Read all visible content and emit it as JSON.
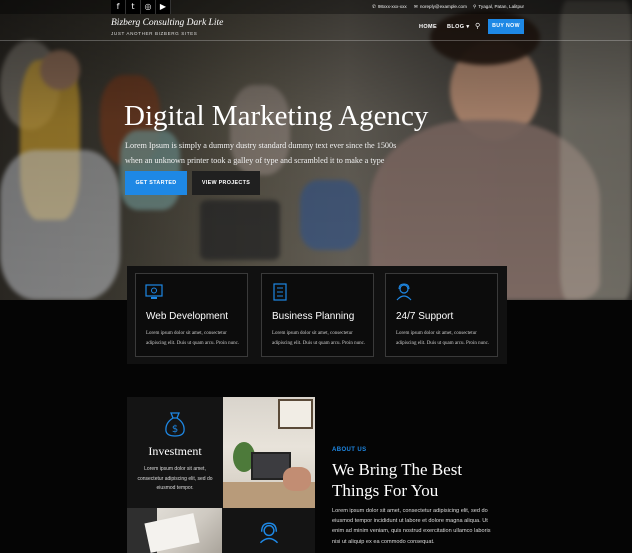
{
  "topbar": {
    "social": [
      {
        "name": "facebook-icon",
        "glyph": "f"
      },
      {
        "name": "twitter-icon",
        "glyph": "t"
      },
      {
        "name": "instagram-icon",
        "glyph": "◎"
      },
      {
        "name": "youtube-icon",
        "glyph": "▶"
      }
    ],
    "phone": "98xxx-xxx-xxx",
    "email": "noreply@example.com",
    "location": "Tyagal, Patan, Lalitpur"
  },
  "header": {
    "site_title": "Bizberg Consulting Dark Lite",
    "tagline": "JUST ANOTHER BIZBERG SITES",
    "nav": {
      "home": "HOME",
      "blog": "BLOG ▾"
    },
    "buy_now": "BUY NOW"
  },
  "hero": {
    "title": "Digital Marketing Agency",
    "description": "Lorem Ipsum is simply a dummy dustry standard dummy text ever since the 1500s when an unknown printer took a galley of type and scrambled it to make a type specimen book.",
    "primary_button": "GET STARTED",
    "secondary_button": "VIEW PROJECTS"
  },
  "features": [
    {
      "title": "Web Development",
      "text": "Lorem ipsum dolor sit amet, consectetur adipiscing elit. Duis ut quam arcu. Proin nunc.",
      "icon": "monitor-settings-icon"
    },
    {
      "title": "Business Planning",
      "text": "Lorem ipsum dolor sit amet, consectetur adipiscing elit. Duis ut quam arcu. Proin nunc.",
      "icon": "checklist-icon"
    },
    {
      "title": "24/7 Support",
      "text": "Lorem ipsum dolor sit amet, consectetur adipiscing elit. Duis ut quam arcu. Proin nunc.",
      "icon": "support-agent-icon"
    }
  ],
  "investment": {
    "title": "Investment",
    "text": "Lorem ipsum dolor sit amet, consectetur adipiscing elit, sed do eiusmod tempor.",
    "icon": "money-bag-icon"
  },
  "about": {
    "label": "ABOUT US",
    "title": "We Bring The Best Things For You",
    "text": "Lorem ipsum dolor sit amet, consectetur adipisicing elit, sed do eiusmod tempor incididunt ut labore et dolore magna aliqua. Ut enim ad minim veniam, quis nostrud exercitation ullamco laboris nisi ut aliquip ex ea commodo consequat."
  },
  "colors": {
    "accent": "#1e88e5",
    "background": "#050505",
    "card": "#111111"
  }
}
